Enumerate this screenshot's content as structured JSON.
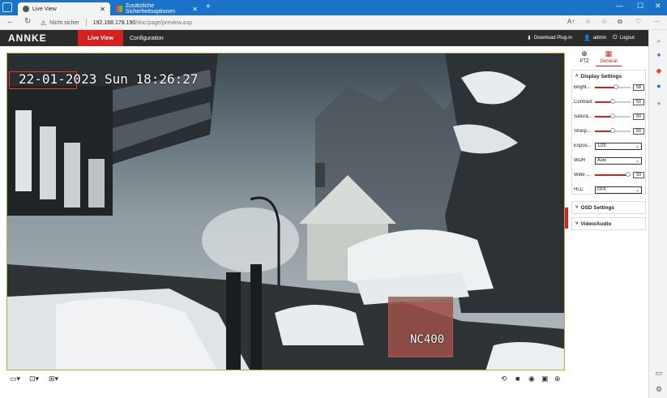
{
  "browser": {
    "tabs": [
      {
        "label": "Live View",
        "active": true
      },
      {
        "label": "Zusätzliche Sicherheitsoptionen",
        "active": false
      }
    ],
    "new_tab_label": "+",
    "window_controls": {
      "minimize": "—",
      "maximize": "☐",
      "close": "✕"
    },
    "security_label": "Nicht sicher",
    "url_host": "192.168.178.190",
    "url_path": "/doc/page/preview.asp",
    "toolbar_icons": [
      "read-aloud-icon",
      "favorite-icon",
      "favorites-list-icon",
      "collections-icon",
      "extension-icon",
      "more-icon"
    ]
  },
  "app": {
    "logo": "ANNKE",
    "nav": {
      "live_view": "Live View",
      "configuration": "Configuration"
    },
    "header": {
      "download_plugin": "Download Plug-in",
      "user": "admin",
      "logout": "Logout"
    }
  },
  "video": {
    "osd_time": "22-01-2023 Sun 18:26:27",
    "osd_name": "NC400"
  },
  "panel": {
    "tabs": [
      {
        "label": "PTZ",
        "icon": "ptz-icon",
        "active": false
      },
      {
        "label": "General",
        "icon": "grid-icon",
        "active": true
      }
    ],
    "display_settings": {
      "title": "Display Settings",
      "brightness": {
        "label": "Bright...",
        "value": "58",
        "fraction": 0.58
      },
      "contrast": {
        "label": "Contrast",
        "value": "50",
        "fraction": 0.5
      },
      "saturation": {
        "label": "Satura...",
        "value": "50",
        "fraction": 0.5
      },
      "sharpness": {
        "label": "Sharp...",
        "value": "50",
        "fraction": 0.5
      },
      "exposure": {
        "label": "Expos...",
        "value": "1/25"
      },
      "wdr": {
        "label": "WDR",
        "value": "Auto"
      },
      "wide": {
        "label": "Wide ...",
        "value": "93",
        "fraction": 0.93
      },
      "hlc": {
        "label": "HLC",
        "value": "OFF"
      }
    },
    "osd_settings": {
      "title": "OSD Settings"
    },
    "video_audio": {
      "title": "Video/Audio"
    }
  },
  "colors": {
    "accent_red": "#d42020",
    "header_bg": "#2b2b2b",
    "edge_blue": "#1a73c8"
  }
}
